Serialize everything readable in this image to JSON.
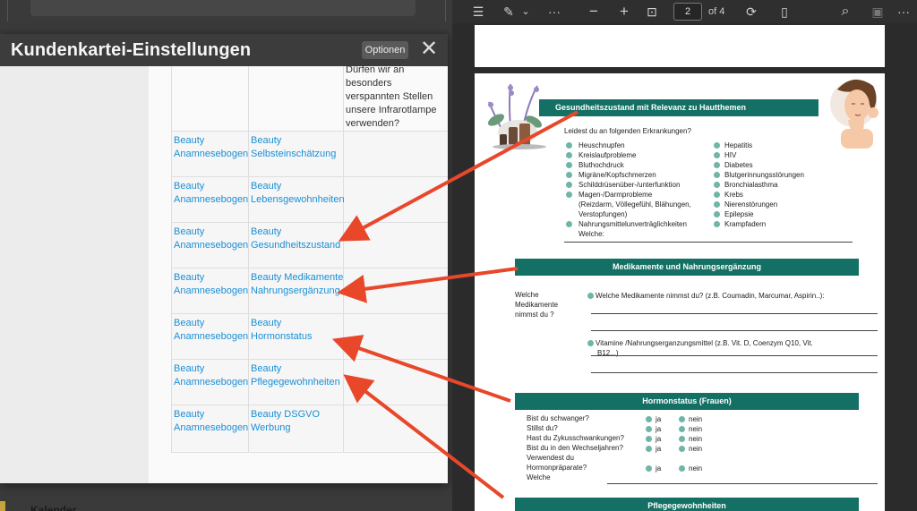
{
  "modal": {
    "title": "Kundenkartei-Einstellungen",
    "options_label": "Optionen",
    "close_glyph": "✕",
    "header_question": [
      "Dürfen wir an",
      "besonders",
      "verspannten Stellen",
      "unsere Infrarotlampe",
      "verwenden?"
    ],
    "rows": [
      {
        "col1": [
          "Beauty",
          "Anamnesebogen"
        ],
        "col2": [
          "Beauty",
          "Selbsteinschätzung"
        ]
      },
      {
        "col1": [
          "Beauty",
          "Anamnesebogen"
        ],
        "col2": [
          "Beauty",
          "Lebensgewohnheiten"
        ]
      },
      {
        "col1": [
          "Beauty",
          "Anamnesebogen"
        ],
        "col2": [
          "Beauty",
          "Gesundheitszustand"
        ]
      },
      {
        "col1": [
          "Beauty",
          "Anamnesebogen"
        ],
        "col2": [
          "Beauty Medikamente",
          "Nahrungsergänzung"
        ]
      },
      {
        "col1": [
          "Beauty",
          "Anamnesebogen"
        ],
        "col2": [
          "Beauty",
          "Hormonstatus"
        ]
      },
      {
        "col1": [
          "Beauty",
          "Anamnesebogen"
        ],
        "col2": [
          "Beauty",
          "Pflegegewohnheiten"
        ]
      },
      {
        "col1": [
          "Beauty",
          "Anamnesebogen"
        ],
        "col2": [
          "Beauty DSGVO",
          "Werbung"
        ]
      }
    ]
  },
  "background": {
    "bottom_label": "Kalender"
  },
  "pdf_toolbar": {
    "list_icon": "☰",
    "draw_icon": "✎",
    "chevron": "⌄",
    "more": "···",
    "zoom_out": "−",
    "zoom_in": "+",
    "fit_icon": "⊡",
    "page_current": "2",
    "page_total_label": "of 4",
    "rotate_icon": "⟳",
    "twopage_icon": "▯",
    "search_icon": "⌕",
    "save_icon": "▣",
    "more2": "···"
  },
  "pdf": {
    "sec_gesundheit": "Gesundheitszustand mit Relevanz zu Hautthemen",
    "leidest": "Leidest du an folgenden Erkrankungen?",
    "diseases_left": [
      "Heuschnupfen",
      "Kreislaufprobleme",
      "Bluthochdruck",
      "Migräne/Kopfschmerzen",
      "Schilddrüsenüber-/unterfunktion",
      "Magen-/Darmprobleme"
    ],
    "magen_detail": [
      "(Reizdarm, Völlegefühl, Blähungen,",
      "Verstopfungen)"
    ],
    "nahrungsmittel": "Nahrungsmittelunverträglichkeiten",
    "welche1": "Welche:",
    "diseases_right": [
      "Hepatitis",
      "HIV",
      "Diabetes",
      "Blutgerinnungsstörungen",
      "Bronchialasthma",
      "Krebs",
      "Nierenstörungen",
      "Epilepsie",
      "Krampfadern"
    ],
    "sec_medikamente": "Medikamente und Nahrungsergänzung",
    "welche_med_left": [
      "Welche",
      "Medikamente",
      "nimmst du ?"
    ],
    "welche_med_q": "Welche Medikamente nimmst du? (z.B. Coumadin, Marcumar, Aspirin..):",
    "vitamine_q": [
      "Vitamine /Nahrungserganzungsmittel (z.B. Vit. D, Coenzym Q10, Vit.",
      "B12,..)"
    ],
    "sec_hormon": "Hormonstatus (Frauen)",
    "hormon_questions": [
      "Bist du schwanger?",
      "Stillst du?",
      "Hast du Zykusschwankungen?",
      "Bist du in den Wechseljahren?"
    ],
    "hormon_q5": [
      "Verwendest du",
      "Hormonpräparate?"
    ],
    "hormon_welche": "Welche",
    "ja": "ja",
    "nein": "nein",
    "sec_pflege": "Pflegegewohnheiten"
  },
  "colors": {
    "accent_teal": "#147064",
    "link_blue": "#1a8fd6",
    "arrow_red": "#e8472a"
  }
}
